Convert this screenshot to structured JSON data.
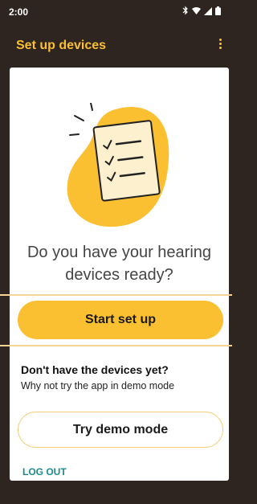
{
  "status_bar": {
    "time": "2:00",
    "icons": [
      "bluetooth-icon",
      "wifi-icon",
      "signal-icon",
      "battery-icon"
    ]
  },
  "app_bar": {
    "title": "Set up devices",
    "menu_icon": "more-vert-icon"
  },
  "main": {
    "illustration": "checklist-illustration",
    "question": "Do you have your hearing devices ready?",
    "start_button_label": "Start set up",
    "no_devices_heading": "Don't have the devices yet?",
    "no_devices_text": "Why not try the app in demo mode",
    "demo_button_label": "Try demo mode",
    "logout_label": "LOG OUT"
  },
  "colors": {
    "background": "#2e2521",
    "accent": "#fbbf32",
    "link": "#1d8a8a"
  }
}
